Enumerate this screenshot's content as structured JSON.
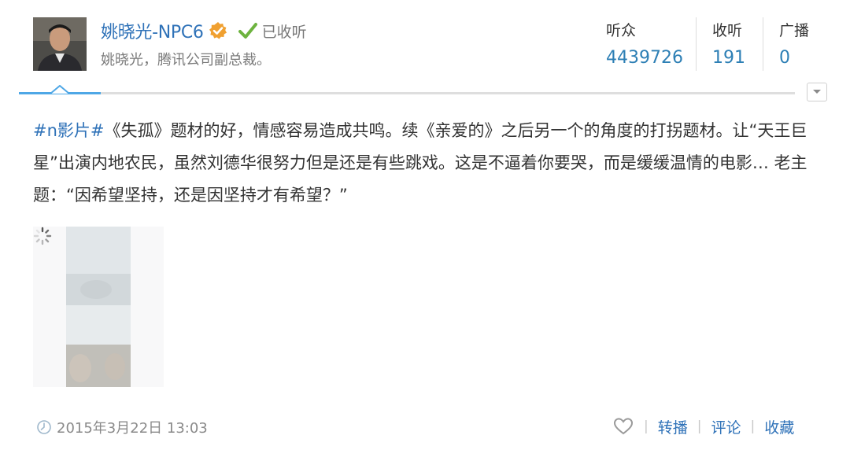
{
  "user": {
    "name": "姚晓光-NPC6",
    "title": "姚晓光，腾讯公司副总裁。",
    "follow_status": "已收听"
  },
  "stats": [
    {
      "label": "听众",
      "value": "4439726"
    },
    {
      "label": "收听",
      "value": "191"
    },
    {
      "label": "广播",
      "value": "0"
    }
  ],
  "post": {
    "hashtag": "#n影片#",
    "text": "《失孤》题材的好，情感容易造成共鸣。续《亲爱的》之后另一个的角度的打拐题材。让“天王巨星”出演内地农民，虽然刘德华很努力但是还是有些跳戏。这是不逼着你要哭，而是缓缓温情的电影… 老主题：“因希望坚持，还是因坚持才有希望？”",
    "timestamp": "2015年3月22日 13:03"
  },
  "actions": {
    "repost": "转播",
    "comment": "评论",
    "favorite": "收藏"
  },
  "icons": {
    "verified": "verified-badge-icon",
    "follow": "check-icon",
    "expand": "chevron-down-icon",
    "time": "clock-icon",
    "like": "heart-icon",
    "loading": "spinner-icon"
  },
  "colors": {
    "link": "#2f72b8",
    "accent": "#4ea7e6",
    "verified": "#f0a030",
    "check": "#6db33f"
  }
}
